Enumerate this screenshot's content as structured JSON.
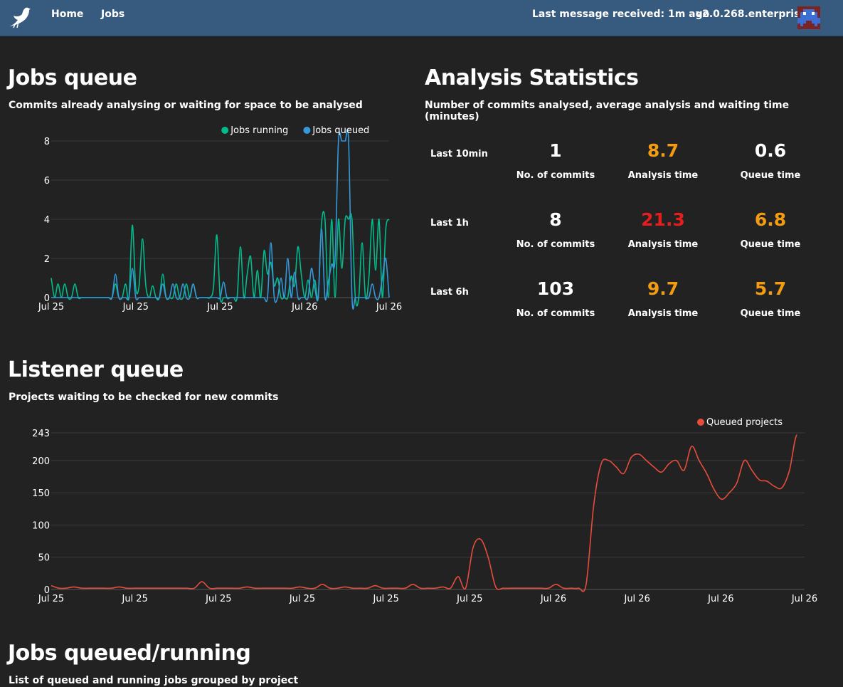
{
  "navbar": {
    "links": [
      "Home",
      "Jobs"
    ],
    "last_message": "Last message received: 1m ago",
    "version": "v2.0.268.enterprise"
  },
  "jobs_queue": {
    "title": "Jobs queue",
    "subtitle": "Commits already analysing or waiting for space to be analysed"
  },
  "analysis_stats": {
    "title": "Analysis Statistics",
    "subtitle": "Number of commits analysed, average analysis and waiting time (minutes)",
    "captions": {
      "commits": "No. of commits",
      "analysis": "Analysis time",
      "queue": "Queue time"
    },
    "colors": {
      "ok": "#ffffff",
      "warn": "#f39c12",
      "bad": "#e61d1d"
    },
    "rows": [
      {
        "label": "Last 10min",
        "commits": "1",
        "analysis": "8.7",
        "analysis_status": "warn",
        "queue": "0.6",
        "queue_status": "ok"
      },
      {
        "label": "Last 1h",
        "commits": "8",
        "analysis": "21.3",
        "analysis_status": "bad",
        "queue": "6.8",
        "queue_status": "warn"
      },
      {
        "label": "Last 6h",
        "commits": "103",
        "analysis": "9.7",
        "analysis_status": "warn",
        "queue": "5.7",
        "queue_status": "warn"
      }
    ]
  },
  "listener_queue": {
    "title": "Listener queue",
    "subtitle": "Projects waiting to be checked for new commits"
  },
  "jobs_list": {
    "title": "Jobs queued/running",
    "subtitle": "List of queued and running jobs grouped by project"
  },
  "chart_data": [
    {
      "type": "line",
      "x_tick_labels": [
        "Jul 25",
        "Jul 25",
        "Jul 25",
        "Jul 26",
        "Jul 26"
      ],
      "ylim": [
        0,
        8
      ],
      "y_ticks": [
        0,
        2,
        4,
        6,
        8
      ],
      "grid": true,
      "legend": "top-right",
      "x": [
        0,
        1,
        2,
        3,
        4,
        5,
        6,
        7,
        8,
        9,
        10,
        11,
        12,
        13,
        14,
        15,
        16,
        17,
        18,
        19,
        20,
        21,
        22,
        23,
        24,
        25,
        26,
        27,
        28,
        29,
        30,
        31,
        32,
        33,
        34,
        35,
        36,
        37,
        38,
        39,
        40,
        41,
        42,
        43,
        44,
        45,
        46,
        47,
        48,
        49,
        50,
        51,
        52,
        53,
        54,
        55,
        56,
        57,
        58,
        59,
        60,
        61,
        62,
        63,
        64,
        65,
        66,
        67,
        68,
        69,
        70,
        71,
        72,
        73,
        74,
        75,
        76,
        77,
        78,
        79,
        80,
        81,
        82,
        83,
        84,
        85,
        86,
        87,
        88,
        89,
        90,
        91,
        92,
        93,
        94,
        95,
        96,
        97,
        98,
        99,
        100
      ],
      "series": [
        {
          "name": "Jobs running",
          "color": "#00bc8c",
          "values": [
            1,
            0,
            0.7,
            0,
            0.7,
            0,
            0,
            0.7,
            0,
            0,
            0,
            0,
            0,
            0,
            0,
            0,
            0,
            0,
            0,
            0.7,
            0,
            0,
            0.7,
            0,
            3.7,
            0.5,
            0.6,
            3.0,
            0.6,
            0,
            0.6,
            0,
            0,
            1.2,
            0,
            0,
            0,
            0.7,
            0,
            0,
            0.7,
            0,
            0.7,
            0,
            0,
            0,
            0,
            0,
            0.5,
            3.2,
            0,
            0,
            0,
            0,
            0,
            0,
            2.6,
            0,
            1.2,
            2.1,
            0,
            1.4,
            0,
            2.4,
            1.2,
            1.8,
            0.6,
            1.0,
            0,
            0,
            0,
            1.1,
            0.6,
            2.6,
            1.2,
            0,
            0.9,
            0,
            0.9,
            0,
            3.8,
            4.0,
            0,
            4.0,
            0,
            4.0,
            1.5,
            4.0,
            4.0,
            4.0,
            0,
            0,
            2.8,
            0,
            1.0,
            4.0,
            1.4,
            4.0,
            0,
            3.5,
            4.0
          ]
        },
        {
          "name": "Jobs queued",
          "color": "#3498db",
          "values": [
            0,
            0,
            0,
            0,
            0,
            0,
            0,
            0,
            0,
            0,
            0,
            0,
            0,
            0,
            0,
            0,
            0,
            0,
            0,
            1.2,
            0,
            0,
            0,
            0,
            1.5,
            0,
            0,
            0,
            0,
            0,
            0,
            0,
            0,
            0.7,
            0,
            0,
            0.7,
            0,
            0,
            0.7,
            0,
            0,
            0.7,
            0,
            0,
            0,
            0,
            0,
            0,
            0,
            0,
            0.8,
            0,
            0,
            0,
            0,
            0,
            0,
            0,
            0,
            0,
            0,
            0,
            0,
            0,
            2.8,
            0,
            0,
            1.0,
            0,
            2.0,
            0,
            1.3,
            0,
            0,
            0,
            0,
            1.5,
            0.5,
            0,
            3.5,
            0,
            0.8,
            1.7,
            2.0,
            8,
            8,
            8,
            8,
            0,
            0,
            0,
            0,
            0,
            0,
            0.7,
            0,
            0,
            1.0,
            2.0,
            0
          ]
        }
      ]
    },
    {
      "type": "line",
      "x_tick_labels": [
        "Jul 25",
        "Jul 25",
        "Jul 25",
        "Jul 25",
        "Jul 25",
        "Jul 25",
        "Jul 26",
        "Jul 26",
        "Jul 26",
        "Jul 26"
      ],
      "ylim": [
        0,
        243
      ],
      "y_ticks": [
        0,
        50,
        100,
        150,
        200,
        243
      ],
      "grid": true,
      "legend": "top-right",
      "x": [
        0,
        1,
        2,
        3,
        4,
        5,
        6,
        7,
        8,
        9,
        10,
        11,
        12,
        13,
        14,
        15,
        16,
        17,
        18,
        19,
        20,
        21,
        22,
        23,
        24,
        25,
        26,
        27,
        28,
        29,
        30,
        31,
        32,
        33,
        34,
        35,
        36,
        37,
        38,
        39,
        40,
        41,
        42,
        43,
        44,
        45,
        46,
        47,
        48,
        49,
        50,
        51,
        52,
        53,
        54,
        55,
        56,
        57,
        58,
        59,
        60,
        61,
        62,
        63,
        64,
        65,
        66,
        67,
        68,
        69,
        70,
        71,
        72,
        73,
        74,
        75,
        76,
        77,
        78,
        79,
        80,
        81,
        82,
        83,
        84,
        85,
        86,
        87,
        88,
        89,
        90,
        91,
        92,
        93,
        94,
        95,
        96,
        97,
        98,
        99,
        100
      ],
      "series": [
        {
          "name": "Queued projects",
          "color": "#e74c3c",
          "values": [
            6,
            2,
            2,
            4,
            2,
            2,
            2,
            2,
            2,
            4,
            2,
            2,
            2,
            2,
            2,
            2,
            2,
            2,
            2,
            2,
            12,
            2,
            2,
            2,
            2,
            2,
            4,
            2,
            2,
            2,
            2,
            2,
            2,
            4,
            2,
            2,
            8,
            2,
            2,
            4,
            2,
            2,
            2,
            6,
            2,
            2,
            2,
            2,
            8,
            2,
            2,
            2,
            4,
            2,
            20,
            2,
            65,
            78,
            50,
            4,
            2,
            2,
            2,
            2,
            2,
            2,
            2,
            8,
            2,
            2,
            2,
            8,
            130,
            195,
            200,
            190,
            180,
            205,
            210,
            200,
            190,
            182,
            195,
            200,
            185,
            222,
            200,
            180,
            155,
            140,
            150,
            165,
            200,
            185,
            170,
            168,
            160,
            158,
            185,
            240,
            195,
            190
          ]
        }
      ]
    }
  ]
}
